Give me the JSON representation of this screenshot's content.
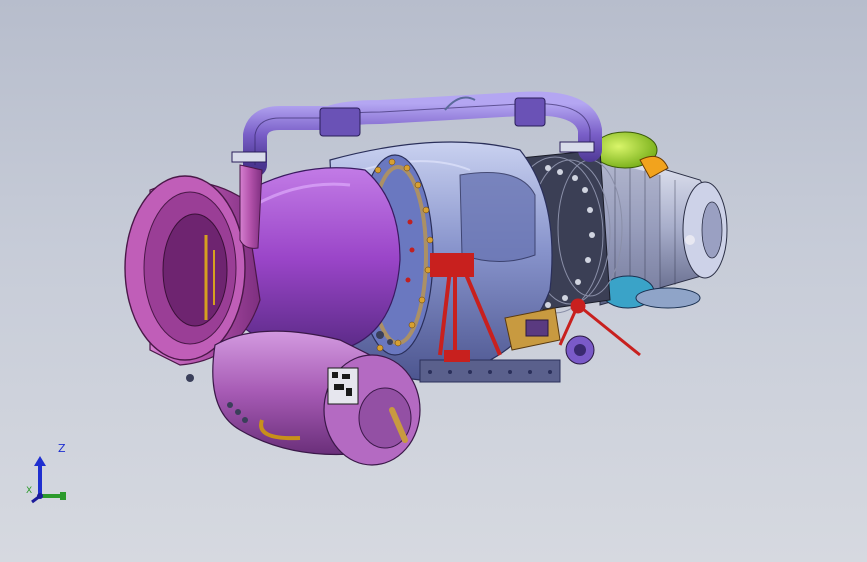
{
  "viewport": {
    "background_top": "#b7bdcc",
    "background_bottom": "#d6d9e0"
  },
  "model": {
    "colors": {
      "inlet": "#b04fa8",
      "plenum_purple": "#9a45c8",
      "combustor_case": "#7f8fc8",
      "exhaust_section": "#3b3f55",
      "exhaust_cone": "#e0e0ee",
      "duct_pipe": "#7a5fc8",
      "oil_tank": "#a65ab4",
      "support_stand": "#c8201e",
      "accessory_gearbox": "#c89a40",
      "green_cap": "#9cd61c",
      "orange_fitting": "#f2a31d",
      "cyan_pump": "#3aa3c8"
    }
  },
  "triad": {
    "z_label": "Z",
    "x_label": "X",
    "z_color": "#1f2fd0",
    "x_color": "#2c9a2c",
    "y_color": "#1c1c9a"
  }
}
